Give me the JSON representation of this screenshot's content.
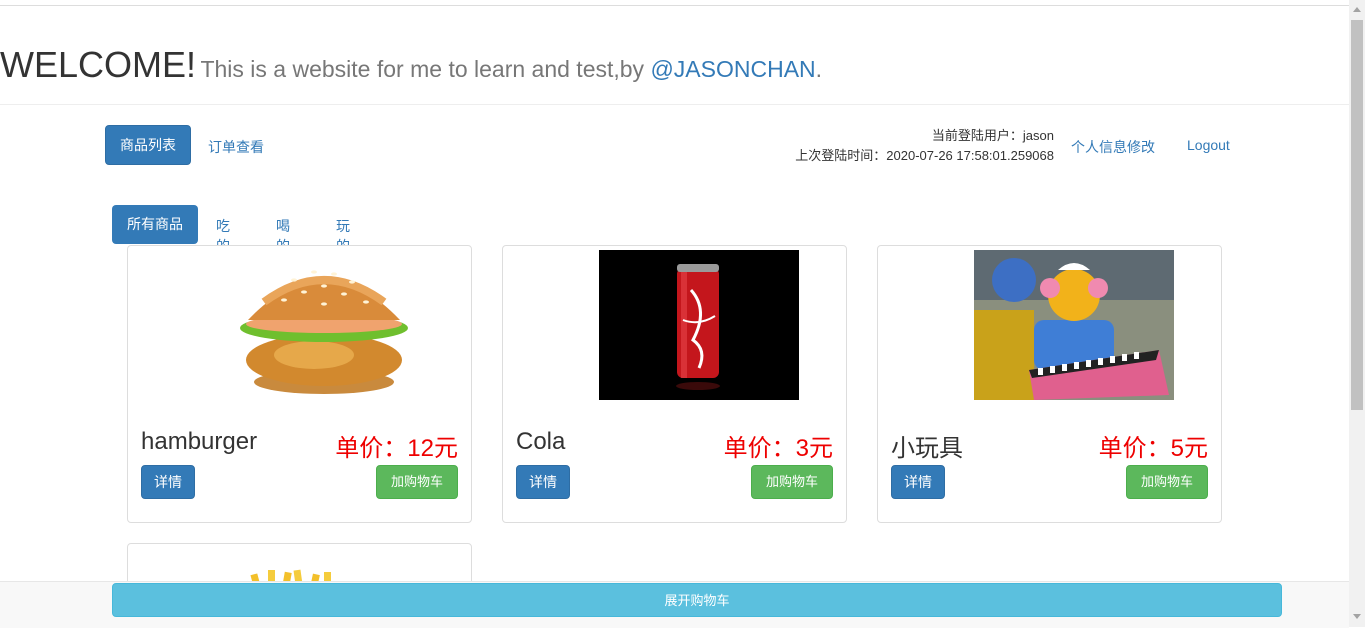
{
  "header": {
    "welcome": "WELCOME!",
    "tagline": "This is a website for me to learn and test,by ",
    "author_link": "@JASONCHAN",
    "period": "."
  },
  "nav": {
    "goods_list": "商品列表",
    "orders": "订单查看",
    "user_line": "当前登陆用户：jason",
    "last_login_line": "上次登陆时间：2020-07-26 17:58:01.259068",
    "profile_edit": "个人信息修改",
    "logout": "Logout"
  },
  "tabs": [
    "所有商品",
    "吃的",
    "喝的",
    "玩的"
  ],
  "products": [
    {
      "name": "hamburger",
      "price": "单价：12元",
      "detail": "详情",
      "add_cart": "加购物车"
    },
    {
      "name": "Cola",
      "price": "单价：3元",
      "detail": "详情",
      "add_cart": "加购物车"
    },
    {
      "name": "小玩具",
      "price": "单价：5元",
      "detail": "详情",
      "add_cart": "加购物车"
    }
  ],
  "footer": {
    "expand_cart": "展开购物车"
  },
  "colors": {
    "primary": "#337ab7",
    "success": "#5cb85c",
    "info": "#5bc0de",
    "price": "#ee0000"
  }
}
